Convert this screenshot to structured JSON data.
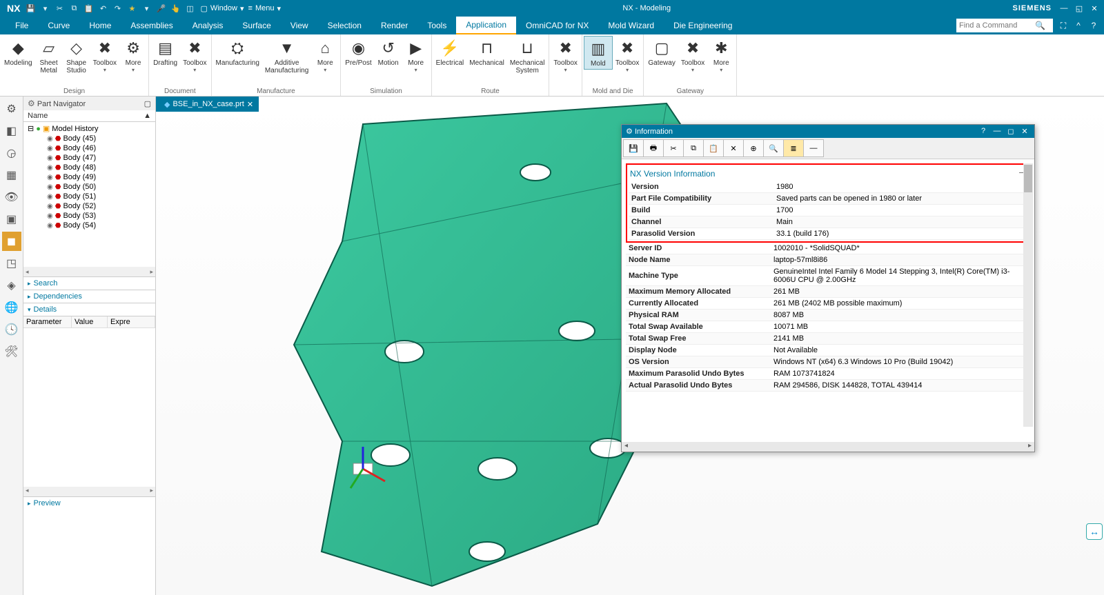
{
  "app": {
    "logo": "NX",
    "window_menu_label": "Window",
    "menu_label": "Menu",
    "title": "NX - Modeling",
    "branding": "SIEMENS"
  },
  "menubar": [
    "File",
    "Curve",
    "Home",
    "Assemblies",
    "Analysis",
    "Surface",
    "View",
    "Selection",
    "Render",
    "Tools",
    "Application",
    "OmniCAD for NX",
    "Mold Wizard",
    "Die Engineering"
  ],
  "menubar_active": "Application",
  "find_command_placeholder": "Find a Command",
  "ribbon": {
    "groups": [
      {
        "label": "Design",
        "buttons": [
          {
            "name": "modeling",
            "label": "Modeling",
            "icon": "◆"
          },
          {
            "name": "sheet-metal",
            "label": "Sheet\nMetal",
            "icon": "▱"
          },
          {
            "name": "shape-studio",
            "label": "Shape\nStudio",
            "icon": "◇"
          },
          {
            "name": "toolbox-design",
            "label": "Toolbox",
            "icon": "✖",
            "dropdown": true
          },
          {
            "name": "more-design",
            "label": "More",
            "icon": "⚙",
            "dropdown": true
          }
        ]
      },
      {
        "label": "Document",
        "buttons": [
          {
            "name": "drafting",
            "label": "Drafting",
            "icon": "▤"
          },
          {
            "name": "toolbox-doc",
            "label": "Toolbox",
            "icon": "✖",
            "dropdown": true
          }
        ]
      },
      {
        "label": "Manufacture",
        "buttons": [
          {
            "name": "manufacturing",
            "label": "Manufacturing",
            "icon": "⛭"
          },
          {
            "name": "additive",
            "label": "Additive\nManufacturing",
            "icon": "▼"
          },
          {
            "name": "more-mfg",
            "label": "More",
            "icon": "⌂",
            "dropdown": true
          }
        ]
      },
      {
        "label": "Simulation",
        "buttons": [
          {
            "name": "prepost",
            "label": "Pre/Post",
            "icon": "◉"
          },
          {
            "name": "motion",
            "label": "Motion",
            "icon": "↺"
          },
          {
            "name": "more-sim",
            "label": "More",
            "icon": "▶",
            "dropdown": true
          }
        ]
      },
      {
        "label": "Route",
        "buttons": [
          {
            "name": "electrical",
            "label": "Electrical",
            "icon": "⚡"
          },
          {
            "name": "mechanical",
            "label": "Mechanical",
            "icon": "⊓"
          },
          {
            "name": "mechsys",
            "label": "Mechanical\nSystem",
            "icon": "⊔"
          }
        ]
      },
      {
        "label": "",
        "buttons": [
          {
            "name": "toolbox-1",
            "label": "Toolbox",
            "icon": "✖",
            "dropdown": true
          }
        ]
      },
      {
        "label": "Mold and Die",
        "buttons": [
          {
            "name": "mold",
            "label": "Mold",
            "icon": "▥",
            "selected": true
          },
          {
            "name": "toolbox-md",
            "label": "Toolbox",
            "icon": "✖",
            "dropdown": true
          }
        ]
      },
      {
        "label": "Gateway",
        "buttons": [
          {
            "name": "gateway",
            "label": "Gateway",
            "icon": "▢"
          },
          {
            "name": "toolbox-gw",
            "label": "Toolbox",
            "icon": "✖",
            "dropdown": true
          },
          {
            "name": "more-gw",
            "label": "More",
            "icon": "✱",
            "dropdown": true
          }
        ]
      }
    ]
  },
  "doc_tab": {
    "label": "BSE_in_NX_case.prt"
  },
  "part_navigator": {
    "title": "Part Navigator",
    "col": "Name",
    "root": "Model History",
    "items": [
      "Body (45)",
      "Body (46)",
      "Body (47)",
      "Body (48)",
      "Body (49)",
      "Body (50)",
      "Body (51)",
      "Body (52)",
      "Body (53)",
      "Body (54)"
    ],
    "sections": {
      "search": "Search",
      "dependencies": "Dependencies",
      "details": "Details",
      "preview": "Preview"
    },
    "details_cols": [
      "Parameter",
      "Value",
      "Expre"
    ]
  },
  "info_dialog": {
    "title": "Information",
    "section_title": "NX Version Information",
    "rows_boxed": [
      [
        "Version",
        "1980"
      ],
      [
        "Part File Compatibility",
        "Saved parts can be opened in 1980 or later"
      ],
      [
        "Build",
        "1700"
      ],
      [
        "Channel",
        "Main"
      ],
      [
        "Parasolid Version",
        "33.1 (build 176)"
      ]
    ],
    "rows_rest": [
      [
        "Server ID",
        "1002010 - *SolidSQUAD*"
      ],
      [
        "Node Name",
        "laptop-57ml8i86"
      ],
      [
        "Machine Type",
        "GenuineIntel Intel Family 6 Model 14 Stepping 3, Intel(R) Core(TM) i3-6006U CPU @ 2.00GHz"
      ],
      [
        "Maximum Memory Allocated",
        "261 MB"
      ],
      [
        "Currently Allocated",
        "261 MB (2402 MB possible maximum)"
      ],
      [
        "Physical RAM",
        "8087 MB"
      ],
      [
        "Total Swap Available",
        "10071 MB"
      ],
      [
        "Total Swap Free",
        "2141 MB"
      ],
      [
        "Display Node",
        "Not Available"
      ],
      [
        "OS Version",
        "Windows NT (x64) 6.3 Windows 10 Pro (Build 19042)"
      ],
      [
        "Maximum Parasolid Undo Bytes",
        "RAM 1073741824"
      ],
      [
        "Actual Parasolid Undo Bytes",
        "RAM 294586, DISK 144828, TOTAL 439414"
      ]
    ]
  }
}
